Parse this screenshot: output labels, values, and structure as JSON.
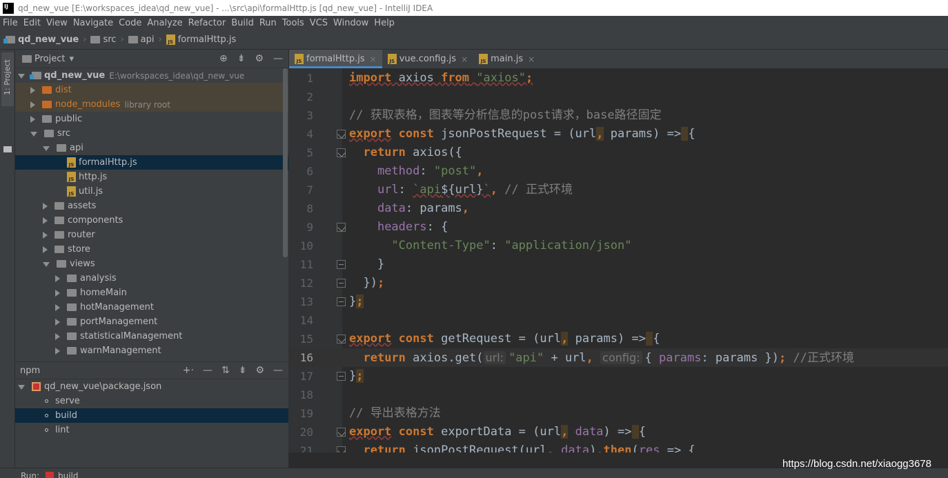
{
  "window": {
    "title": "qd_new_vue [E:\\workspaces_idea\\qd_new_vue] - ...\\src\\api\\formalHttp.js [qd_new_vue] - IntelliJ IDEA",
    "logo": "IJ"
  },
  "menu": [
    "File",
    "Edit",
    "View",
    "Navigate",
    "Code",
    "Analyze",
    "Refactor",
    "Build",
    "Run",
    "Tools",
    "VCS",
    "Window",
    "Help"
  ],
  "breadcrumbs": [
    "qd_new_vue",
    "src",
    "api",
    "formalHttp.js"
  ],
  "left_strip": {
    "project_tab": "1: Project"
  },
  "project_panel": {
    "title": "Project",
    "tree": [
      {
        "label": "qd_new_vue",
        "extra": "E:\\workspaces_idea\\qd_new_vue",
        "level": 0,
        "arrow": "down",
        "icon": "module-folder-icon"
      },
      {
        "label": "dist",
        "level": 1,
        "arrow": "right",
        "icon": "folder-orange-icon",
        "ignored": true
      },
      {
        "label": "node_modules",
        "extra": "library root",
        "level": 1,
        "arrow": "right",
        "icon": "folder-orange-icon",
        "ignored": true
      },
      {
        "label": "public",
        "level": 1,
        "arrow": "right",
        "icon": "folder-icon"
      },
      {
        "label": "src",
        "level": 1,
        "arrow": "down",
        "icon": "folder-icon"
      },
      {
        "label": "api",
        "level": 2,
        "arrow": "down",
        "icon": "folder-icon"
      },
      {
        "label": "formalHttp.js",
        "level": 3,
        "icon": "js-file-icon",
        "selected": true
      },
      {
        "label": "http.js",
        "level": 3,
        "icon": "js-file-icon"
      },
      {
        "label": "util.js",
        "level": 3,
        "icon": "js-file-icon"
      },
      {
        "label": "assets",
        "level": 2,
        "arrow": "right",
        "icon": "folder-icon"
      },
      {
        "label": "components",
        "level": 2,
        "arrow": "right",
        "icon": "folder-icon"
      },
      {
        "label": "router",
        "level": 2,
        "arrow": "right",
        "icon": "folder-icon"
      },
      {
        "label": "store",
        "level": 2,
        "arrow": "right",
        "icon": "folder-icon"
      },
      {
        "label": "views",
        "level": 2,
        "arrow": "down",
        "icon": "folder-icon"
      },
      {
        "label": "analysis",
        "level": 3,
        "arrow": "right",
        "icon": "folder-icon"
      },
      {
        "label": "homeMain",
        "level": 3,
        "arrow": "right",
        "icon": "folder-icon"
      },
      {
        "label": "hotManagement",
        "level": 3,
        "arrow": "right",
        "icon": "folder-icon"
      },
      {
        "label": "portManagement",
        "level": 3,
        "arrow": "right",
        "icon": "folder-icon"
      },
      {
        "label": "statisticalManagement",
        "level": 3,
        "arrow": "right",
        "icon": "folder-icon"
      },
      {
        "label": "warnManagement",
        "level": 3,
        "arrow": "right",
        "icon": "folder-icon"
      }
    ]
  },
  "npm_panel": {
    "title": "npm",
    "package": "qd_new_vue\\package.json",
    "scripts": [
      {
        "label": "serve",
        "selected": false
      },
      {
        "label": "build",
        "selected": true
      },
      {
        "label": "lint",
        "selected": false
      }
    ]
  },
  "bottom_bar": {
    "run_label": "Run:",
    "config": "build"
  },
  "editor_tabs": [
    {
      "label": "formalHttp.js",
      "active": true
    },
    {
      "label": "vue.config.js",
      "active": false
    },
    {
      "label": "main.js",
      "active": false
    }
  ],
  "code_lines": [
    {
      "n": "1",
      "fold": "",
      "tokens": [
        [
          "kw u",
          "import"
        ],
        [
          "tx u",
          " axios "
        ],
        [
          "kw u",
          "from"
        ],
        [
          "tx u",
          " "
        ],
        [
          "str u",
          "\"axios\""
        ],
        [
          "kw u",
          ";"
        ]
      ]
    },
    {
      "n": "2",
      "fold": "",
      "tokens": []
    },
    {
      "n": "3",
      "fold": "",
      "tokens": [
        [
          "cm",
          "// 获取表格，图表等分析信息的post请求，base路径固定"
        ]
      ]
    },
    {
      "n": "4",
      "fold": "open",
      "tokens": [
        [
          "kw u",
          "export"
        ],
        [
          "tx",
          " "
        ],
        [
          "kw",
          "const"
        ],
        [
          "tx",
          " jsonPostRequest = (url"
        ],
        [
          "kw hl",
          ","
        ],
        [
          "tx",
          " params) "
        ],
        [
          "tx",
          "=>"
        ],
        [
          "tx hl",
          " "
        ],
        [
          "tx",
          "{"
        ]
      ]
    },
    {
      "n": "5",
      "fold": "open",
      "tokens": [
        [
          "tx",
          "  "
        ],
        [
          "kw",
          "return"
        ],
        [
          "tx",
          " axios({"
        ]
      ]
    },
    {
      "n": "6",
      "fold": "",
      "tokens": [
        [
          "tx",
          "    "
        ],
        [
          "prop",
          "method"
        ],
        [
          "tx",
          ": "
        ],
        [
          "str",
          "\"post\""
        ],
        [
          "kw",
          ","
        ]
      ]
    },
    {
      "n": "7",
      "fold": "",
      "tokens": [
        [
          "tx",
          "    "
        ],
        [
          "prop",
          "url"
        ],
        [
          "tx",
          ": "
        ],
        [
          "str u",
          "`api"
        ],
        [
          "tx u",
          "${url}"
        ],
        [
          "str u",
          "`"
        ],
        [
          "kw",
          ","
        ],
        [
          "cm",
          " // 正式环境"
        ]
      ]
    },
    {
      "n": "8",
      "fold": "",
      "tokens": [
        [
          "tx",
          "    "
        ],
        [
          "prop",
          "data"
        ],
        [
          "tx",
          ": params"
        ],
        [
          "kw",
          ","
        ]
      ]
    },
    {
      "n": "9",
      "fold": "open",
      "tokens": [
        [
          "tx",
          "    "
        ],
        [
          "prop",
          "headers"
        ],
        [
          "tx",
          ": {"
        ]
      ]
    },
    {
      "n": "10",
      "fold": "",
      "tokens": [
        [
          "tx",
          "      "
        ],
        [
          "str",
          "\"Content-Type\""
        ],
        [
          "tx",
          ": "
        ],
        [
          "str",
          "\"application/json\""
        ]
      ]
    },
    {
      "n": "11",
      "fold": "close",
      "tokens": [
        [
          "tx",
          "    }"
        ]
      ]
    },
    {
      "n": "12",
      "fold": "close",
      "tokens": [
        [
          "tx",
          "  })"
        ],
        [
          "kw",
          ";"
        ]
      ]
    },
    {
      "n": "13",
      "fold": "close",
      "tokens": [
        [
          "tx",
          "}"
        ],
        [
          "kw hl",
          ";"
        ]
      ]
    },
    {
      "n": "14",
      "fold": "",
      "tokens": []
    },
    {
      "n": "15",
      "fold": "open",
      "tokens": [
        [
          "kw u",
          "export"
        ],
        [
          "tx",
          " "
        ],
        [
          "kw",
          "const"
        ],
        [
          "tx",
          " getRequest = (url"
        ],
        [
          "kw hl",
          ","
        ],
        [
          "tx",
          " params) "
        ],
        [
          "tx",
          "=>"
        ],
        [
          "tx hl",
          " "
        ],
        [
          "tx",
          "{"
        ]
      ]
    },
    {
      "n": "16",
      "fold": "",
      "cur": true,
      "tokens": [
        [
          "tx",
          "  "
        ],
        [
          "kw",
          "return"
        ],
        [
          "tx",
          " axios.get("
        ],
        [
          "hint",
          "url:"
        ],
        [
          "str",
          "\"api\""
        ],
        [
          "tx",
          " + url"
        ],
        [
          "kw",
          ","
        ],
        [
          "tx",
          " "
        ],
        [
          "hint",
          "config:"
        ],
        [
          "tx",
          "{ "
        ],
        [
          "prop",
          "params"
        ],
        [
          "tx",
          ": params })"
        ],
        [
          "kw",
          ";"
        ],
        [
          "cm",
          " //正式环境"
        ]
      ]
    },
    {
      "n": "17",
      "fold": "close",
      "tokens": [
        [
          "tx",
          "}"
        ],
        [
          "kw hl",
          ";"
        ]
      ]
    },
    {
      "n": "18",
      "fold": "",
      "tokens": []
    },
    {
      "n": "19",
      "fold": "",
      "tokens": [
        [
          "cm",
          "// 导出表格方法"
        ]
      ]
    },
    {
      "n": "20",
      "fold": "open",
      "tokens": [
        [
          "kw u",
          "export"
        ],
        [
          "tx",
          " "
        ],
        [
          "kw",
          "const"
        ],
        [
          "tx",
          " exportData = (url"
        ],
        [
          "kw hl",
          ","
        ],
        [
          "tx",
          " "
        ],
        [
          "prop",
          "data"
        ],
        [
          "tx",
          ") "
        ],
        [
          "tx",
          "=>"
        ],
        [
          "tx hl",
          " "
        ],
        [
          "tx",
          "{"
        ]
      ]
    },
    {
      "n": "21",
      "fold": "open",
      "tokens": [
        [
          "tx",
          "  "
        ],
        [
          "kw",
          "return"
        ],
        [
          "tx",
          " jsonPostRequest(url"
        ],
        [
          "kw",
          ","
        ],
        [
          "tx",
          " "
        ],
        [
          "prop",
          "data"
        ],
        [
          "tx",
          ")."
        ],
        [
          "kw",
          "then"
        ],
        [
          "tx",
          "("
        ],
        [
          "prop",
          "res"
        ],
        [
          "tx",
          " => {"
        ]
      ]
    }
  ],
  "watermark": "https://blog.csdn.net/xiaogg3678",
  "colors": {
    "keyword": "#cc7832",
    "string": "#6a8759",
    "comment": "#808080",
    "property": "#9876aa",
    "text": "#a9b7c6",
    "selection": "#0d293e",
    "tab_underline": "#4a88c7"
  }
}
